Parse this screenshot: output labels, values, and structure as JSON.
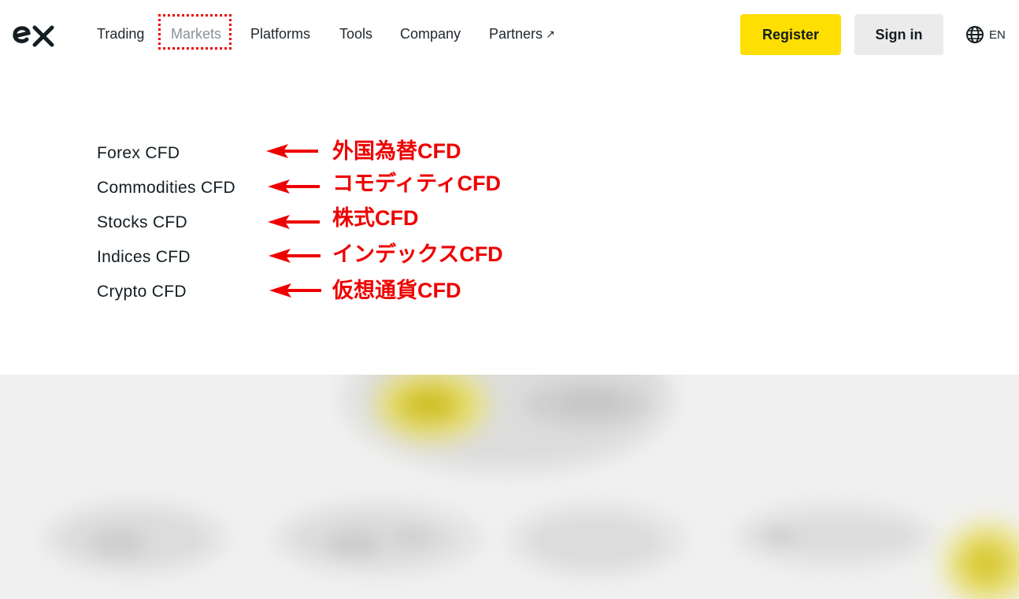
{
  "header": {
    "logo_icon": "exness-ex-logo-icon",
    "nav": [
      {
        "label": "Trading"
      },
      {
        "label": "Markets"
      },
      {
        "label": "Platforms"
      },
      {
        "label": "Tools"
      },
      {
        "label": "Company"
      },
      {
        "label": "Partners"
      }
    ],
    "partners_icon": "external-arrow-icon",
    "register_label": "Register",
    "signin_label": "Sign in",
    "language_icon": "globe-icon",
    "language_label": "EN"
  },
  "markets_menu": {
    "items": [
      {
        "label": "Forex CFD",
        "annotation": "外国為替CFD"
      },
      {
        "label": "Commodities CFD",
        "annotation": "コモディティCFD"
      },
      {
        "label": "Stocks CFD",
        "annotation": "株式CFD"
      },
      {
        "label": "Indices CFD",
        "annotation": "インデックスCFD"
      },
      {
        "label": "Crypto CFD",
        "annotation": "仮想通貨CFD"
      }
    ]
  },
  "colors": {
    "brand_yellow": "#ffde02",
    "annotation_red": "#ee0000",
    "secondary_button": "#ebebeb",
    "text_dark": "#141d22",
    "active_nav_text": "#8a9096"
  }
}
